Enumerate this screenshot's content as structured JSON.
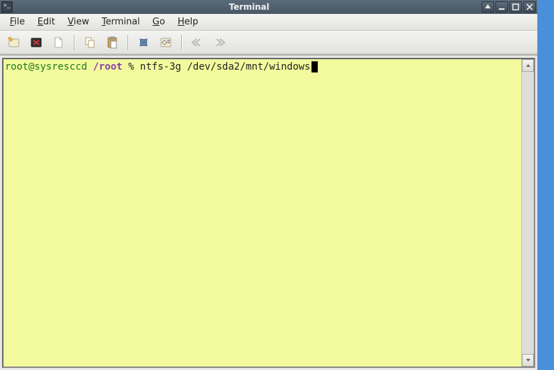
{
  "title": "Terminal",
  "menus": {
    "file": "File",
    "edit": "Edit",
    "view": "View",
    "terminal": "Terminal",
    "go": "Go",
    "help": "Help"
  },
  "toolbar_icons": {
    "new_tab": "new-tab-icon",
    "close_tab": "close-tab-icon",
    "new_doc": "new-doc-icon",
    "copy": "copy-icon",
    "paste": "paste-icon",
    "fullscreen": "fullscreen-icon",
    "settings": "settings-icon",
    "prev": "prev-icon",
    "next": "next-icon"
  },
  "prompt": {
    "user_host": "root@sysresccd",
    "path": "/root",
    "symbol": "%",
    "command": "ntfs-3g /dev/sda2/mnt/windows"
  },
  "terminal_bg": "#f3f99d"
}
